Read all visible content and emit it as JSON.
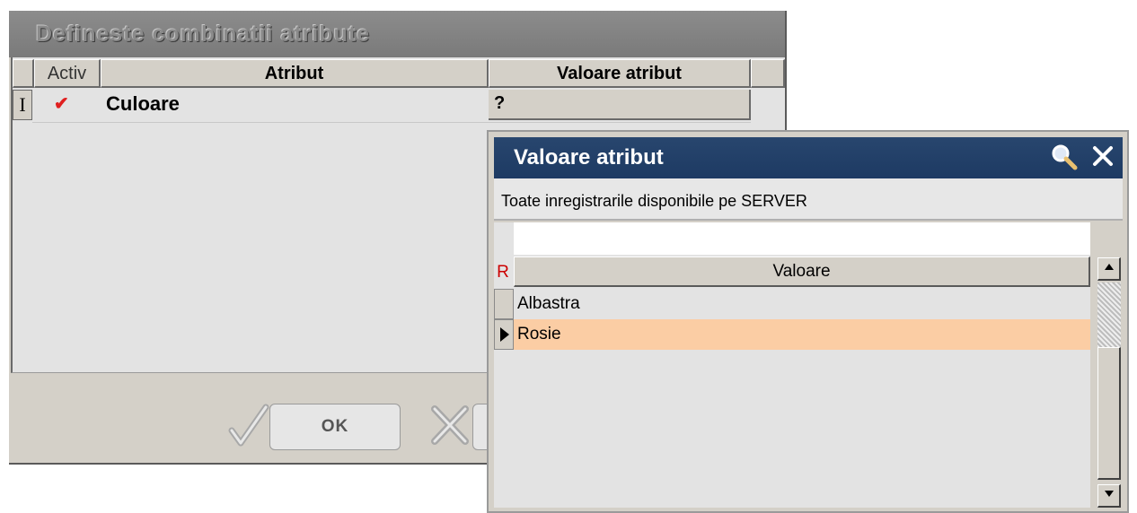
{
  "dialog": {
    "title": "Defineste combinatii atribute",
    "columns": {
      "activ": "Activ",
      "atribut": "Atribut",
      "valoare": "Valoare atribut"
    },
    "row": {
      "marker": "I",
      "active_mark": "✔",
      "attribute": "Culoare",
      "value": "?"
    },
    "ok_label": "OK"
  },
  "popup": {
    "title": "Valoare atribut",
    "subtitle": "Toate inregistrarile disponibile pe SERVER",
    "filter_value": "",
    "r_button": "R",
    "column_header": "Valoare",
    "items": [
      {
        "label": "Albastra",
        "selected": false
      },
      {
        "label": "Rosie",
        "selected": true
      }
    ]
  },
  "colors": {
    "selection": "#fbcda4",
    "popup_title_bar": "#1d3a63",
    "check_mark": "#e02020"
  },
  "icons": [
    "check-icon",
    "cancel-x-icon",
    "search-icon",
    "close-icon",
    "row-pointer-icon",
    "scroll-up-icon",
    "scroll-down-icon"
  ]
}
